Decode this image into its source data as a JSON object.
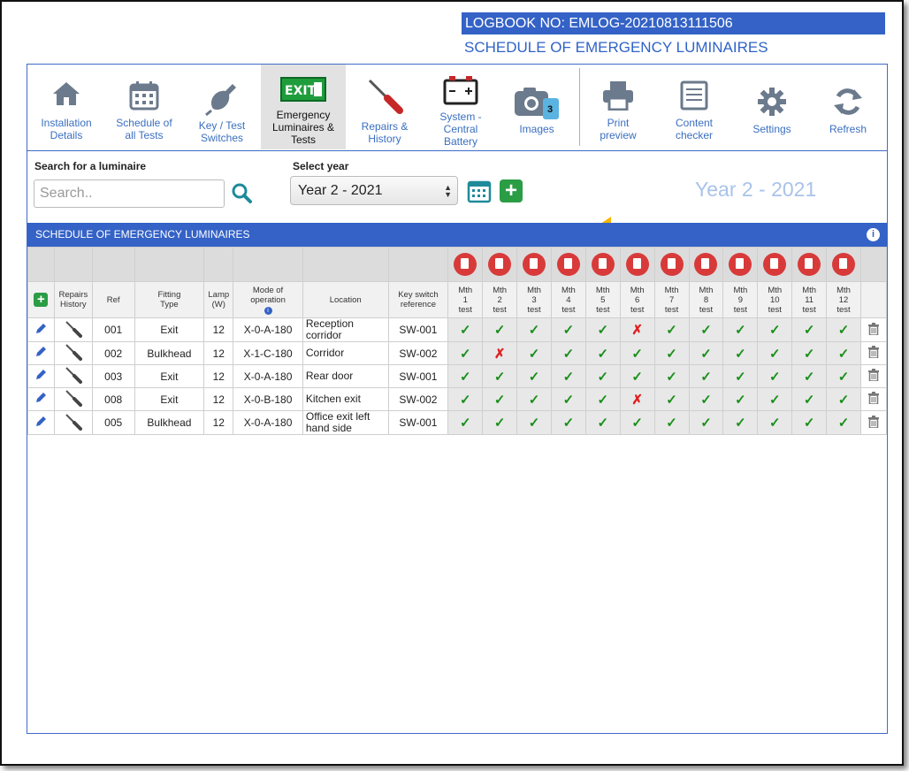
{
  "header": {
    "logbook": "LOGBOOK NO: EMLOG-20210813111506",
    "title": "SCHEDULE OF EMERGENCY LUMINAIRES"
  },
  "toolbar": {
    "items": [
      {
        "label": "Installation\nDetails",
        "icon": "house-icon"
      },
      {
        "label": "Schedule of\nall Tests",
        "icon": "calendar-icon"
      },
      {
        "label": "Key / Test\nSwitches",
        "icon": "test-switch-icon"
      },
      {
        "label": "Emergency\nLuminaires &\nTests",
        "icon": "exit-sign-icon",
        "badge": "EXIT"
      },
      {
        "label": "Repairs &\nHistory",
        "icon": "screwdriver-icon"
      },
      {
        "label": "System -\nCentral\nBattery",
        "icon": "battery-icon"
      },
      {
        "label": "Images",
        "icon": "camera-icon",
        "badge": "3"
      },
      {
        "label": "Print\npreview",
        "icon": "printer-icon"
      },
      {
        "label": "Content\nchecker",
        "icon": "checklist-icon"
      },
      {
        "label": "Settings",
        "icon": "gear-icon"
      },
      {
        "label": "Refresh",
        "icon": "refresh-icon"
      }
    ]
  },
  "search": {
    "label": "Search for a luminaire",
    "placeholder": "Search.."
  },
  "year": {
    "label": "Select year",
    "selected": "Year 2 - 2021",
    "display": "Year 2 - 2021"
  },
  "banner": {
    "title": "SCHEDULE OF EMERGENCY LUMINAIRES",
    "info": "i"
  },
  "colors": {
    "accent": "#3462c6",
    "ok": "#1a8f1a",
    "fail": "#e02020",
    "add": "#2a9d45",
    "highlight_arrow": "#f7b500"
  },
  "table": {
    "headers": {
      "repairs": "Repairs\nHistory",
      "ref": "Ref",
      "fitting": "Fitting\nType",
      "lamp": "Lamp\n(W)",
      "mode": "Mode of\noperation",
      "location": "Location",
      "keyswitch": "Key switch\nreference",
      "months": [
        "Mth\n1\ntest",
        "Mth\n2\ntest",
        "Mth\n3\ntest",
        "Mth\n4\ntest",
        "Mth\n5\ntest",
        "Mth\n6\ntest",
        "Mth\n7\ntest",
        "Mth\n8\ntest",
        "Mth\n9\ntest",
        "Mth\n10\ntest",
        "Mth\n11\ntest",
        "Mth\n12\ntest"
      ]
    },
    "rows": [
      {
        "ref": "001",
        "fitting": "Exit",
        "lamp": "12",
        "mode": "X-0-A-180",
        "location": "Reception corridor",
        "keyswitch": "SW-001",
        "results": [
          "pass",
          "pass",
          "pass",
          "pass",
          "pass",
          "fail",
          "pass",
          "pass",
          "pass",
          "pass",
          "pass",
          "pass"
        ]
      },
      {
        "ref": "002",
        "fitting": "Bulkhead",
        "lamp": "12",
        "mode": "X-1-C-180",
        "location": "Corridor",
        "keyswitch": "SW-002",
        "results": [
          "pass",
          "fail",
          "pass",
          "pass",
          "pass",
          "pass",
          "pass",
          "pass",
          "pass",
          "pass",
          "pass",
          "pass"
        ]
      },
      {
        "ref": "003",
        "fitting": "Exit",
        "lamp": "12",
        "mode": "X-0-A-180",
        "location": "Rear door",
        "keyswitch": "SW-001",
        "results": [
          "pass",
          "pass",
          "pass",
          "pass",
          "pass",
          "pass",
          "pass",
          "pass",
          "pass",
          "pass",
          "pass",
          "pass"
        ]
      },
      {
        "ref": "008",
        "fitting": "Exit",
        "lamp": "12",
        "mode": "X-0-B-180",
        "location": "Kitchen exit",
        "keyswitch": "SW-002",
        "results": [
          "pass",
          "pass",
          "pass",
          "pass",
          "pass",
          "fail",
          "pass",
          "pass",
          "pass",
          "pass",
          "pass",
          "pass"
        ]
      },
      {
        "ref": "005",
        "fitting": "Bulkhead",
        "lamp": "12",
        "mode": "X-0-A-180",
        "location": "Office exit left hand side",
        "keyswitch": "SW-001",
        "results": [
          "pass",
          "pass",
          "pass",
          "pass",
          "pass",
          "pass",
          "pass",
          "pass",
          "pass",
          "pass",
          "pass",
          "pass"
        ]
      }
    ]
  }
}
